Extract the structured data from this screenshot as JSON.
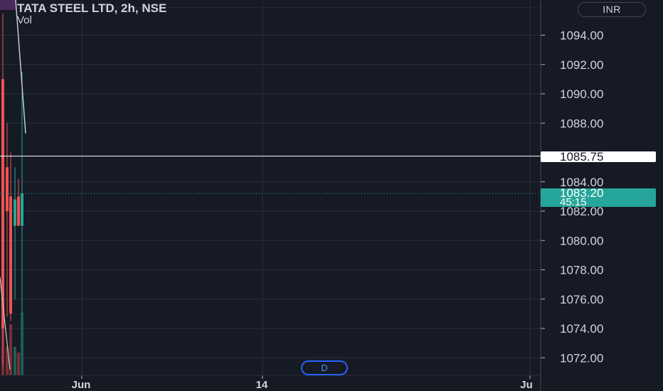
{
  "legend": {
    "symbol": "TATA STEEL LTD, 2h, NSE",
    "volume_label": "Vol"
  },
  "currency": "INR",
  "d_button": "D",
  "crosshair_price": "1085.75",
  "last_price": {
    "value": "1083.20",
    "countdown": "45:15"
  },
  "colors": {
    "background": "#161a25",
    "grid": "#2a2e39",
    "up": "#26a69a",
    "down": "#ef5350",
    "volume_up": "#1b5e57",
    "volume_down": "#7a2f33",
    "crosshair": "#ffffff",
    "accent": "#2962ff"
  },
  "chart_data": {
    "type": "candlestick",
    "title": "TATA STEEL LTD, 2h, NSE",
    "currency": "INR",
    "price_axis": {
      "ticks": [
        "1094.00",
        "1092.00",
        "1090.00",
        "1088.00",
        "1084.00",
        "1082.00",
        "1080.00",
        "1078.00",
        "1076.00",
        "1074.00",
        "1072.00"
      ],
      "range": [
        1070.8,
        1096.4
      ],
      "position": "right"
    },
    "time_axis": {
      "ticks": [
        "Jun",
        "14",
        "Ju"
      ]
    },
    "grid": true,
    "candles": [
      {
        "open": 1091.0,
        "high": 1095.5,
        "low": 1071.5,
        "close": 1074.0,
        "direction": "down"
      },
      {
        "open": 1085.0,
        "high": 1088.0,
        "low": 1074.8,
        "close": 1082.0,
        "direction": "down"
      },
      {
        "open": 1083.0,
        "high": 1086.0,
        "low": 1074.5,
        "close": 1075.0,
        "direction": "down"
      },
      {
        "open": 1081.0,
        "high": 1085.0,
        "low": 1076.0,
        "close": 1082.8,
        "direction": "up"
      },
      {
        "open": 1083.0,
        "high": 1084.2,
        "low": 1081.0,
        "close": 1081.0,
        "direction": "down"
      },
      {
        "open": 1081.0,
        "high": 1091.5,
        "low": 1075.0,
        "close": 1083.2,
        "direction": "up"
      }
    ],
    "volume": [
      0.45,
      0.25,
      0.45,
      0.25,
      0.2,
      0.55
    ],
    "indicator_line": [
      {
        "price": 1096.4
      },
      {
        "price": 1087.3
      }
    ],
    "last_price": 1083.2,
    "crosshair_price": 1085.75
  }
}
